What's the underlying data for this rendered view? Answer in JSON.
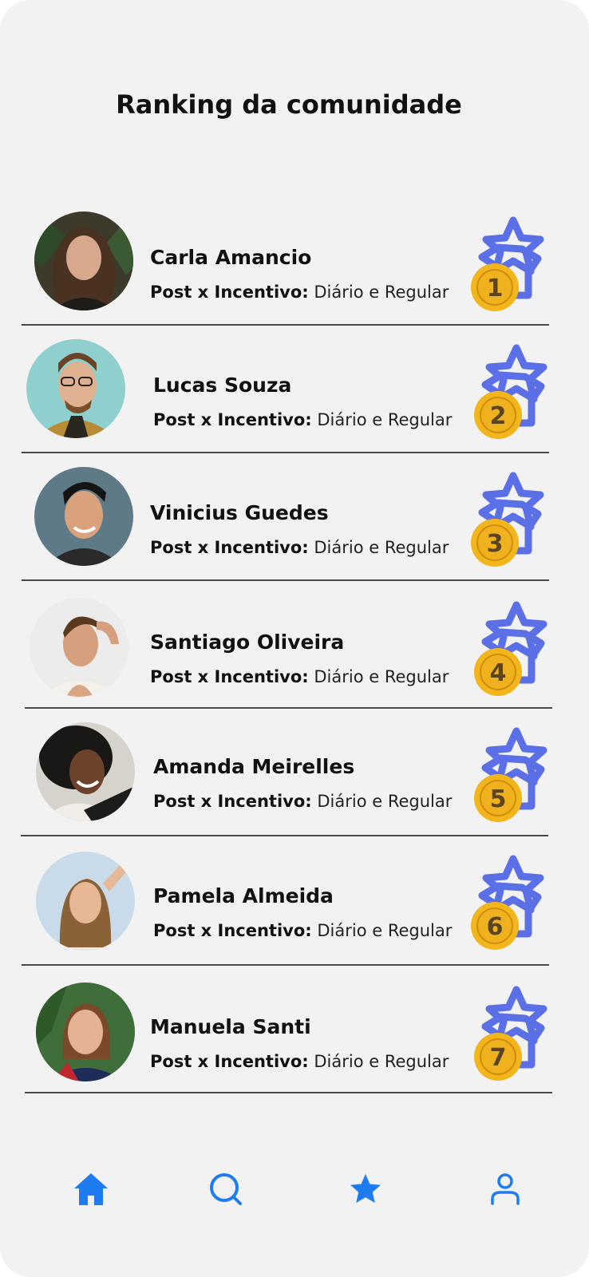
{
  "page": {
    "title": "Ranking da comunidade"
  },
  "ranking_label": "Post x Incentivo:",
  "entries": [
    {
      "rank": "1",
      "name": "Carla Amancio",
      "value": "Diário e Regular"
    },
    {
      "rank": "2",
      "name": "Lucas Souza",
      "value": "Diário e Regular"
    },
    {
      "rank": "3",
      "name": "Vinicius Guedes",
      "value": "Diário e Regular"
    },
    {
      "rank": "4",
      "name": "Santiago Oliveira",
      "value": "Diário e Regular"
    },
    {
      "rank": "5",
      "name": "Amanda Meirelles",
      "value": "Diário e Regular"
    },
    {
      "rank": "6",
      "name": "Pamela Almeida",
      "value": "Diário e Regular"
    },
    {
      "rank": "7",
      "name": "Manuela Santi",
      "value": "Diário e Regular"
    }
  ],
  "nav": {
    "items": [
      {
        "icon": "home-icon"
      },
      {
        "icon": "search-icon"
      },
      {
        "icon": "star-icon"
      },
      {
        "icon": "profile-icon"
      }
    ]
  },
  "colors": {
    "background": "#f2f2f2",
    "accent_blue": "#1e7cf0",
    "badge_blue": "#5b6fe6",
    "medal_gold": "#f2b51c"
  }
}
